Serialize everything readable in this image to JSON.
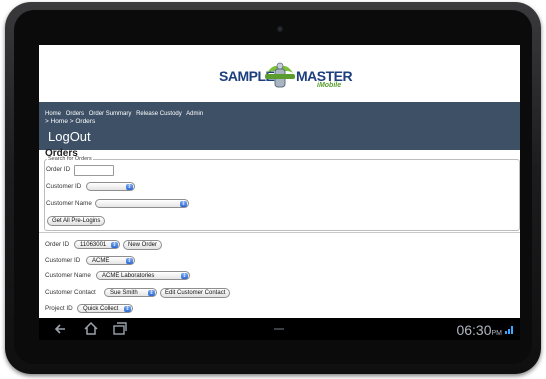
{
  "app": {
    "logo_left": "SAMPLE",
    "logo_right": "MASTER",
    "logo_sub": "iMobile"
  },
  "nav": {
    "links": [
      "Home",
      "Orders",
      "Order Summary",
      "Release Custody",
      "Admin"
    ],
    "breadcrumb": "> Home > Orders",
    "logout": "LogOut"
  },
  "orders": {
    "heading": "Orders",
    "search_legend": "Search for Orders",
    "order_id_label": "Order ID",
    "order_id_value": "",
    "customer_id_label": "Customer ID",
    "customer_id_value": "",
    "customer_name_label": "Customer Name",
    "customer_name_value": "",
    "get_prelogins_label": "Get All Pre-Logins"
  },
  "detail": {
    "order_id_label": "Order ID",
    "order_id_value": "11063001",
    "new_order_label": "New Order",
    "customer_id_label": "Customer ID",
    "customer_id_value": "ACME",
    "customer_name_label": "Customer Name",
    "customer_name_value": "ACME Laboratories",
    "customer_contact_label": "Customer Contact",
    "customer_contact_value": "Sue Smith",
    "edit_contact_label": "Edit Customer Contact",
    "project_id_label": "Project ID",
    "project_id_value": "Quick Collect"
  },
  "system_bar": {
    "time": "06:30",
    "ampm": "PM",
    "icons": [
      "back-icon",
      "home-icon",
      "recent-apps-icon",
      "signal-icon"
    ]
  },
  "colors": {
    "nav_bg": "#3d5066",
    "brand_blue": "#1d3f7d",
    "brand_green": "#5a9c2e"
  }
}
